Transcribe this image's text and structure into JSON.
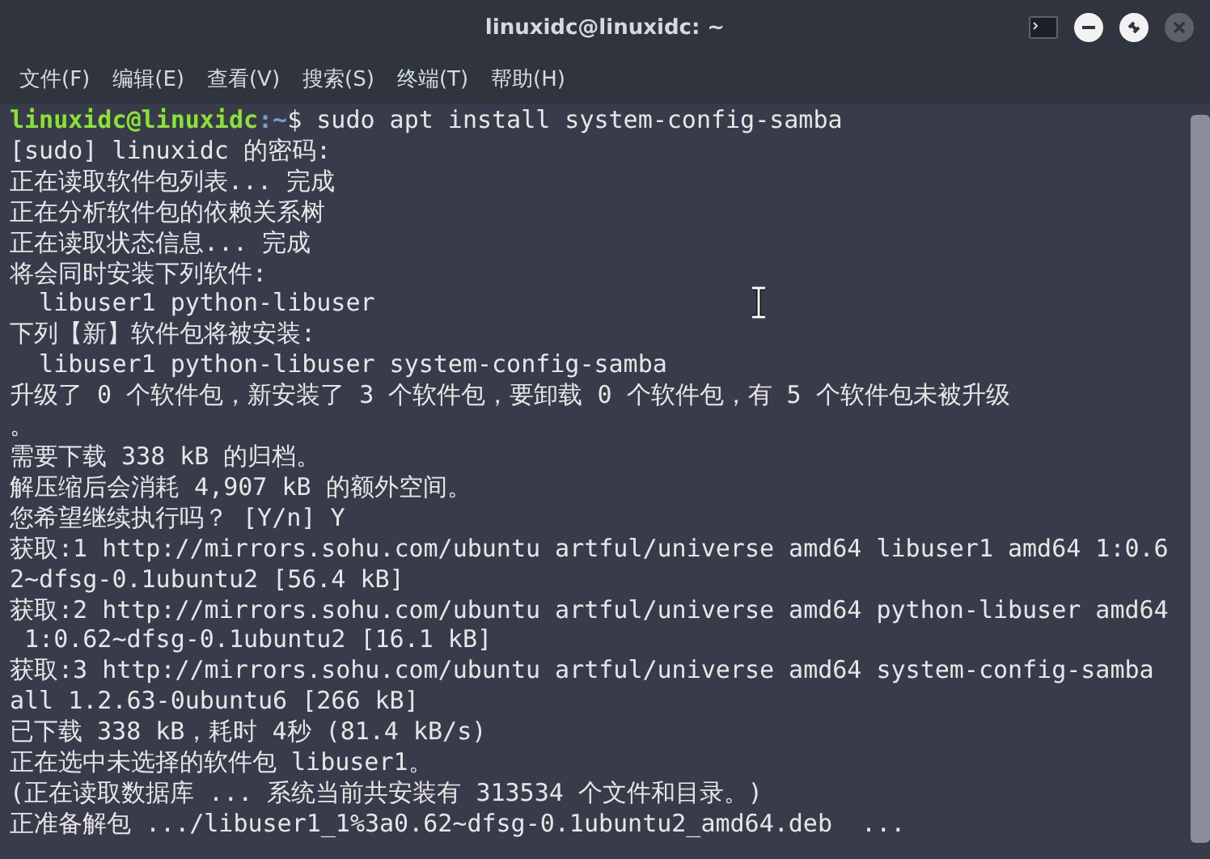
{
  "window": {
    "title": "linuxidc@linuxidc: ~"
  },
  "menu": [
    "文件(F)",
    "编辑(E)",
    "查看(V)",
    "搜索(S)",
    "终端(T)",
    "帮助(H)"
  ],
  "terminal": {
    "lines": [
      {
        "kind": "prompt",
        "user_host": "linuxidc@linuxidc",
        "path": ":~",
        "command": "$ sudo apt install system-config-samba"
      },
      {
        "kind": "output",
        "text": "[sudo] linuxidc 的密码:"
      },
      {
        "kind": "output",
        "text": "正在读取软件包列表... 完成"
      },
      {
        "kind": "output",
        "text": "正在分析软件包的依赖关系树"
      },
      {
        "kind": "output",
        "text": "正在读取状态信息... 完成"
      },
      {
        "kind": "output",
        "text": "将会同时安装下列软件:"
      },
      {
        "kind": "output",
        "text": "  libuser1 python-libuser"
      },
      {
        "kind": "output",
        "text": "下列【新】软件包将被安装:"
      },
      {
        "kind": "output",
        "text": "  libuser1 python-libuser system-config-samba"
      },
      {
        "kind": "output",
        "text": "升级了 0 个软件包，新安装了 3 个软件包，要卸载 0 个软件包，有 5 个软件包未被升级"
      },
      {
        "kind": "output",
        "text": "。"
      },
      {
        "kind": "output",
        "text": "需要下载 338 kB 的归档。"
      },
      {
        "kind": "output",
        "text": "解压缩后会消耗 4,907 kB 的额外空间。"
      },
      {
        "kind": "output",
        "text": "您希望继续执行吗？ [Y/n] Y"
      },
      {
        "kind": "output",
        "text": "获取:1 http://mirrors.sohu.com/ubuntu artful/universe amd64 libuser1 amd64 1:0.6"
      },
      {
        "kind": "output",
        "text": "2~dfsg-0.1ubuntu2 [56.4 kB]"
      },
      {
        "kind": "output",
        "text": "获取:2 http://mirrors.sohu.com/ubuntu artful/universe amd64 python-libuser amd64"
      },
      {
        "kind": "output",
        "text": " 1:0.62~dfsg-0.1ubuntu2 [16.1 kB]"
      },
      {
        "kind": "output",
        "text": "获取:3 http://mirrors.sohu.com/ubuntu artful/universe amd64 system-config-samba"
      },
      {
        "kind": "output",
        "text": "all 1.2.63-0ubuntu6 [266 kB]"
      },
      {
        "kind": "output",
        "text": "已下载 338 kB，耗时 4秒 (81.4 kB/s)"
      },
      {
        "kind": "output",
        "text": "正在选中未选择的软件包 libuser1。"
      },
      {
        "kind": "output",
        "text": "(正在读取数据库 ... 系统当前共安装有 313534 个文件和目录。)"
      },
      {
        "kind": "output",
        "text": "正准备解包 .../libuser1_1%3a0.62~dfsg-0.1ubuntu2_amd64.deb  ..."
      }
    ]
  }
}
